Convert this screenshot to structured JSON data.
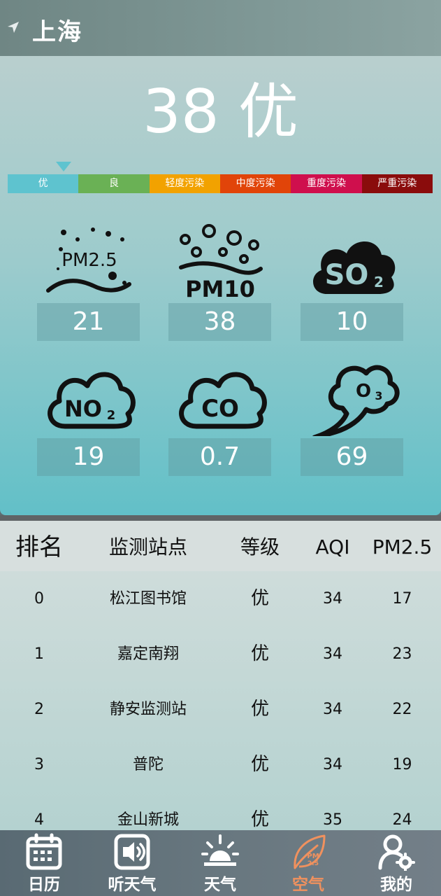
{
  "header": {
    "city": "上海",
    "location_icon": "location-arrow-icon"
  },
  "aqi": {
    "value": "38",
    "level": "优",
    "display": "38 优"
  },
  "scale": [
    {
      "label": "优",
      "color": "#5ec3cf"
    },
    {
      "label": "良",
      "color": "#6ab155"
    },
    {
      "label": "轻度污染",
      "color": "#f2a200"
    },
    {
      "label": "中度污染",
      "color": "#e14409"
    },
    {
      "label": "重度污染",
      "color": "#cf0f4d"
    },
    {
      "label": "严重污染",
      "color": "#8a0c0c"
    }
  ],
  "pollutants": [
    {
      "name": "PM2.5",
      "value": "21",
      "icon": "pm25-icon"
    },
    {
      "name": "PM10",
      "value": "38",
      "icon": "pm10-icon"
    },
    {
      "name": "SO2",
      "value": "10",
      "icon": "so2-icon"
    },
    {
      "name": "NO2",
      "value": "19",
      "icon": "no2-icon"
    },
    {
      "name": "CO",
      "value": "0.7",
      "icon": "co-icon"
    },
    {
      "name": "O3",
      "value": "69",
      "icon": "o3-icon"
    }
  ],
  "table": {
    "headers": [
      "排名",
      "监测站点",
      "等级",
      "AQI",
      "PM2.5"
    ],
    "rows": [
      [
        "0",
        "松江图书馆",
        "优",
        "34",
        "17"
      ],
      [
        "1",
        "嘉定南翔",
        "优",
        "34",
        "23"
      ],
      [
        "2",
        "静安监测站",
        "优",
        "34",
        "22"
      ],
      [
        "3",
        "普陀",
        "优",
        "34",
        "19"
      ],
      [
        "4",
        "金山新城",
        "优",
        "35",
        "24"
      ]
    ]
  },
  "nav": [
    {
      "label": "日历",
      "icon": "calendar-icon",
      "active": false
    },
    {
      "label": "听天气",
      "icon": "speaker-icon",
      "active": false
    },
    {
      "label": "天气",
      "icon": "sunrise-icon",
      "active": false
    },
    {
      "label": "空气",
      "icon": "leaf-pm25-icon",
      "active": true
    },
    {
      "label": "我的",
      "icon": "user-gear-icon",
      "active": false
    }
  ],
  "colors": {
    "accent": "#f0915e",
    "text_light": "#ffffff"
  }
}
